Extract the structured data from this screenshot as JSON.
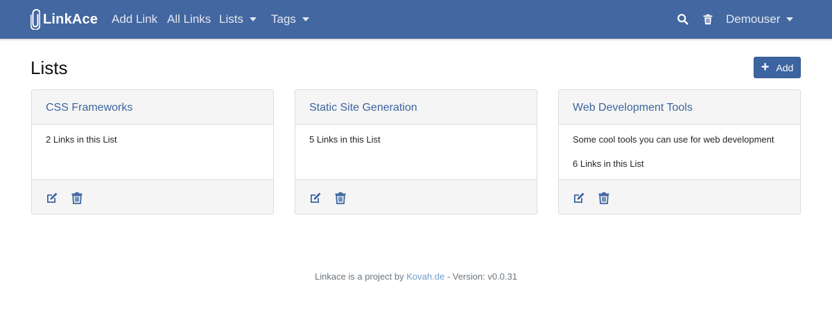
{
  "nav": {
    "brand": "LinkAce",
    "add_link": "Add Link",
    "all_links": "All Links",
    "lists": "Lists",
    "tags": "Tags",
    "user": "Demouser",
    "search_icon": "search-icon",
    "trash_icon": "trash-icon"
  },
  "page": {
    "title": "Lists",
    "add_button": "Add"
  },
  "lists": [
    {
      "title": "CSS Frameworks",
      "description": "",
      "count": "2 Links in this List"
    },
    {
      "title": "Static Site Generation",
      "description": "",
      "count": "5 Links in this List"
    },
    {
      "title": "Web Development Tools",
      "description": "Some cool tools you can use for web development",
      "count": "6 Links in this List"
    }
  ],
  "footer": {
    "prefix": "Linkace is a project by",
    "link": "Kovah.de",
    "version": "- Version: v0.0.31"
  },
  "colors": {
    "navbar": "#4367a0",
    "accent": "#3c64a0",
    "footer_link": "#6f9ad0"
  }
}
